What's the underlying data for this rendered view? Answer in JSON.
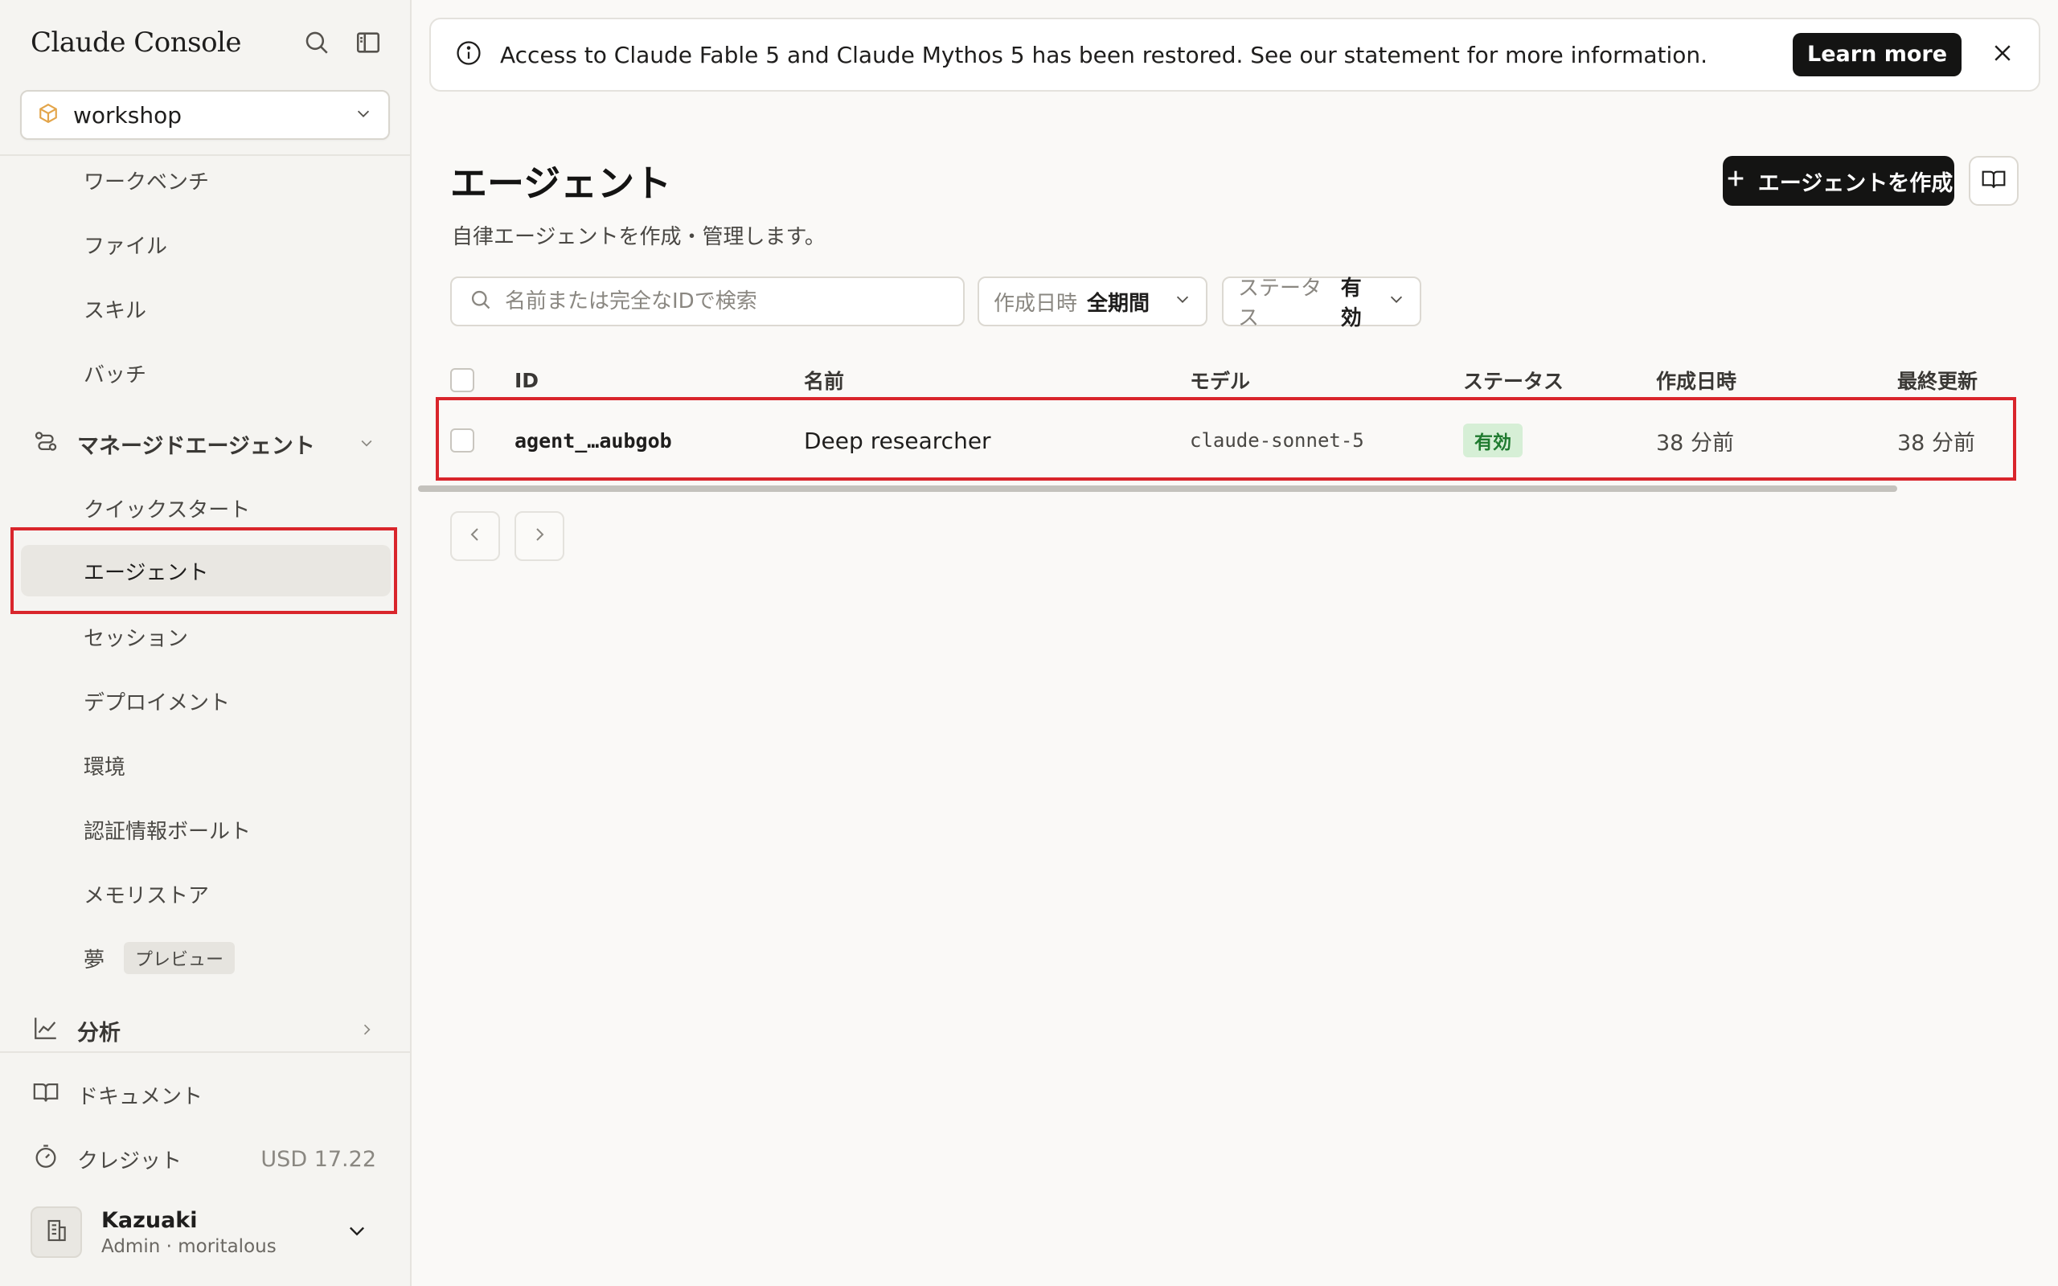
{
  "app": {
    "title": "Claude Console",
    "workspace": "workshop"
  },
  "sidebar": {
    "items_top": [
      {
        "label": "ワークベンチ"
      },
      {
        "label": "ファイル"
      },
      {
        "label": "スキル"
      },
      {
        "label": "バッチ"
      }
    ],
    "managed_section": "マネージドエージェント",
    "managed_items": [
      {
        "label": "クイックスタート"
      },
      {
        "label": "エージェント"
      },
      {
        "label": "セッション"
      },
      {
        "label": "デプロイメント"
      },
      {
        "label": "環境"
      },
      {
        "label": "認証情報ボールト"
      },
      {
        "label": "メモリストア"
      },
      {
        "label": "夢",
        "badge": "プレビュー"
      }
    ],
    "analytics": "分析",
    "docs": "ドキュメント",
    "credits": {
      "label": "クレジット",
      "value": "USD 17.22"
    },
    "user": {
      "name": "Kazuaki",
      "role": "Admin",
      "org": "moritalous",
      "sep": "·"
    }
  },
  "banner": {
    "text": "Access to Claude Fable 5 and Claude Mythos 5 has been restored. See our statement for more information.",
    "learn_more": "Learn more"
  },
  "main": {
    "title": "エージェント",
    "subtitle": "自律エージェントを作成・管理します。",
    "create_button": "エージェントを作成",
    "search_placeholder": "名前または完全なIDで検索",
    "filters": {
      "created": {
        "label": "作成日時",
        "value": "全期間"
      },
      "status": {
        "label": "ステータス",
        "value": "有効"
      }
    },
    "table": {
      "headers": {
        "id": "ID",
        "name": "名前",
        "model": "モデル",
        "status": "ステータス",
        "created": "作成日時",
        "updated": "最終更新"
      },
      "rows": [
        {
          "id": "agent_…aubgob",
          "name": "Deep researcher",
          "model": "claude-sonnet-5",
          "status": "有効",
          "created": "38 分前",
          "updated": "38 分前"
        }
      ]
    }
  },
  "colors": {
    "accent_dark": "#141413",
    "highlight": "#d9252b",
    "status_green": "#1f7a2f",
    "workspace_icon": "#e3a54a"
  }
}
